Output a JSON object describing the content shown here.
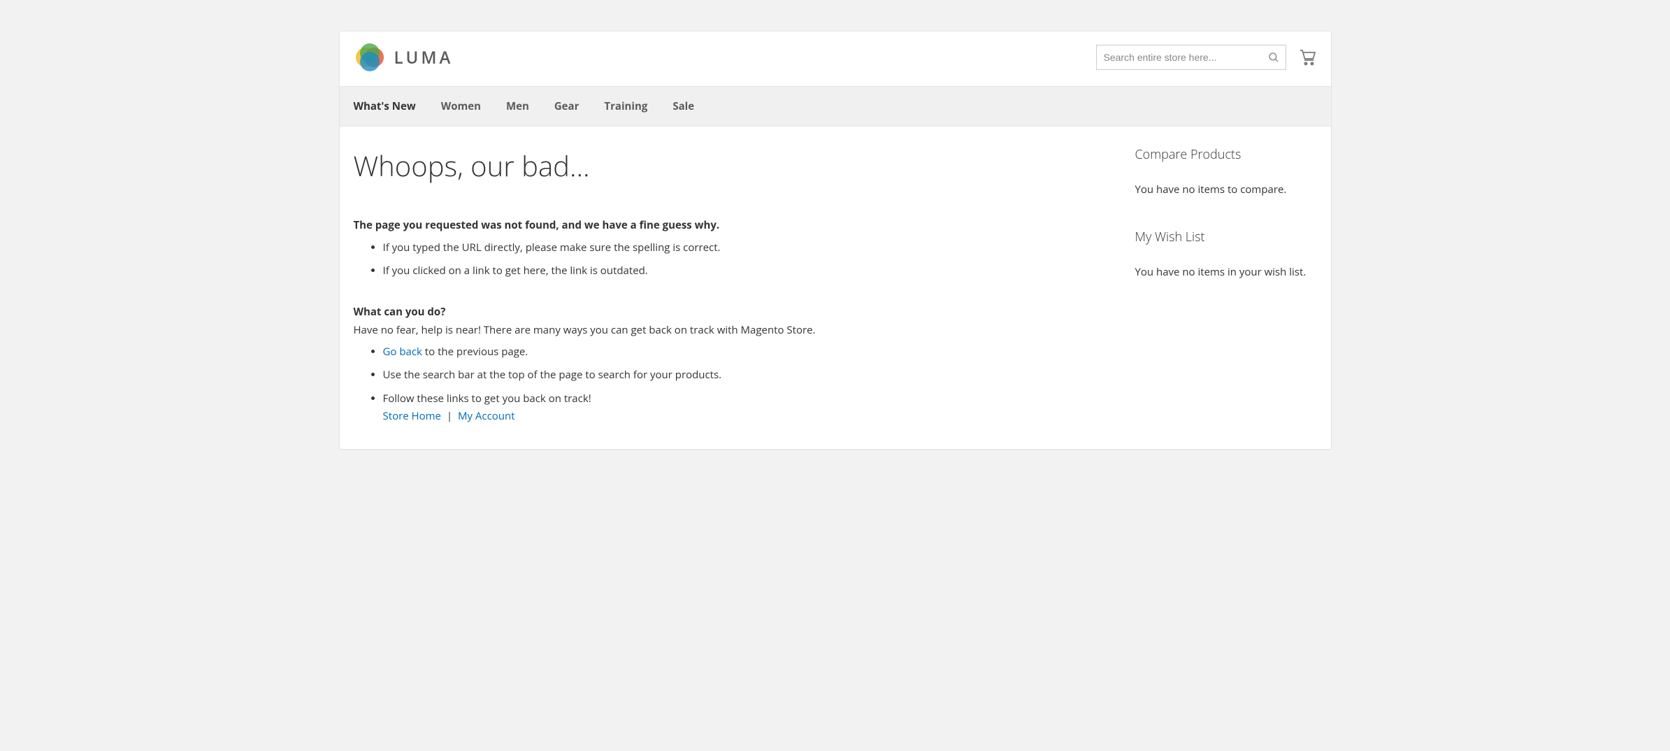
{
  "brand": {
    "name": "LUMA"
  },
  "search": {
    "placeholder": "Search entire store here..."
  },
  "nav": {
    "items": [
      {
        "label": "What's New"
      },
      {
        "label": "Women"
      },
      {
        "label": "Men"
      },
      {
        "label": "Gear"
      },
      {
        "label": "Training"
      },
      {
        "label": "Sale"
      }
    ]
  },
  "page": {
    "title": "Whoops, our bad...",
    "not_found_heading": "The page you requested was not found, and we have a fine guess why.",
    "reasons": [
      "If you typed the URL directly, please make sure the spelling is correct.",
      "If you clicked on a link to get here, the link is outdated."
    ],
    "help_heading": "What can you do?",
    "help_intro": "Have no fear, help is near! There are many ways you can get back on track with Magento Store.",
    "go_back_link": "Go back",
    "go_back_rest": " to the previous page.",
    "use_search": "Use the search bar at the top of the page to search for your products.",
    "follow_links": "Follow these links to get you back on track!",
    "store_home": "Store Home",
    "sep": "|",
    "my_account": "My Account"
  },
  "sidebar": {
    "compare": {
      "title": "Compare Products",
      "empty": "You have no items to compare."
    },
    "wishlist": {
      "title": "My Wish List",
      "empty": "You have no items in your wish list."
    }
  }
}
